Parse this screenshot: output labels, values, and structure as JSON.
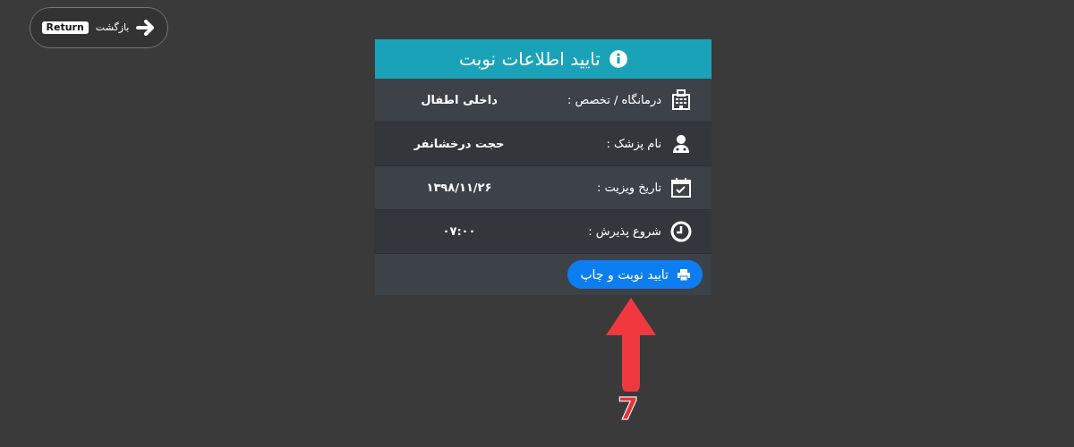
{
  "back_button": {
    "label": "بازگشت",
    "badge": "Return"
  },
  "card": {
    "title": "تایید اطلاعات نوبت",
    "rows": [
      {
        "kind": "clinic",
        "label": "درمانگاه / تخصص :",
        "value": "داخلی اطفال"
      },
      {
        "kind": "doctor",
        "label": "نام پزشک :",
        "value": "حجت درخشانفر"
      },
      {
        "kind": "calendar",
        "label": "تاریخ ویزیت :",
        "value": "۱۳۹۸/۱۱/۲۶"
      },
      {
        "kind": "clock",
        "label": "شروع پذیرش :",
        "value": "۰۷:۰۰"
      }
    ],
    "confirm_button": {
      "label": "تایید نوبت و چاپ"
    }
  },
  "annotation": {
    "step": "7"
  }
}
